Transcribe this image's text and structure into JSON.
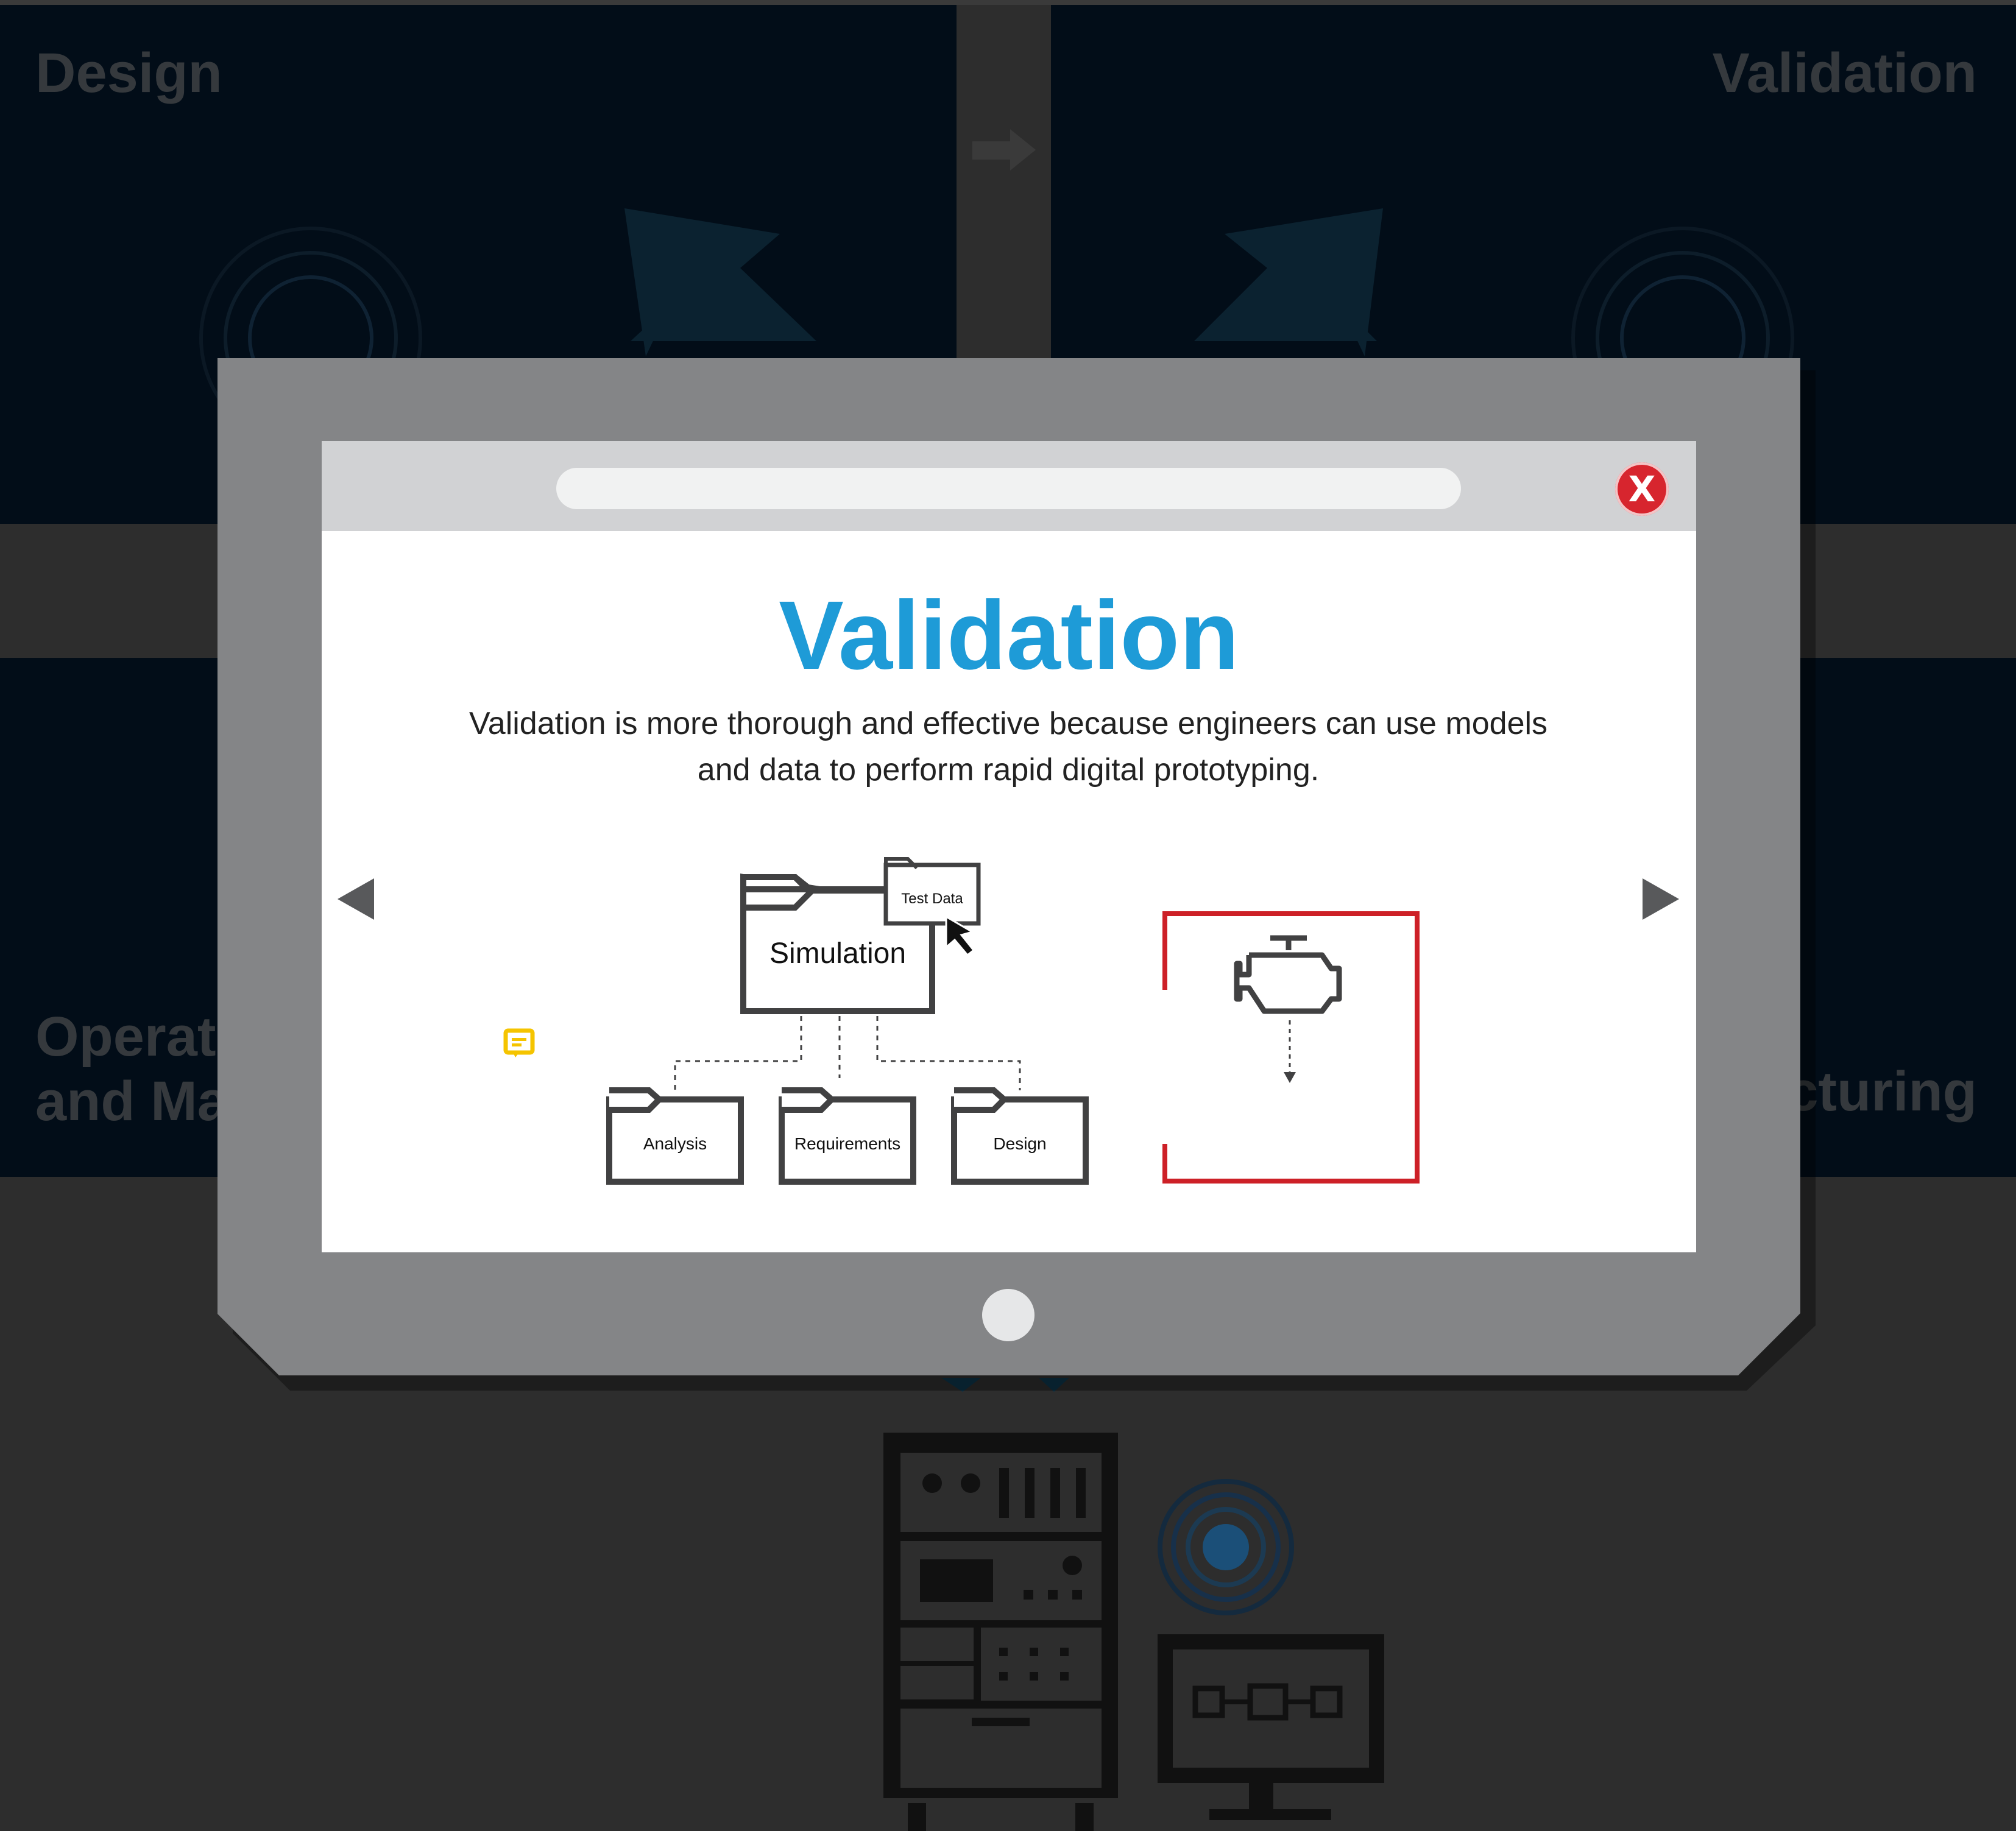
{
  "quadrants": {
    "design": "Design",
    "validation": "Validation",
    "operations": "Operat\nand Ma",
    "manufacturing": "cturing"
  },
  "modal": {
    "title": "Validation",
    "description": "Validation is more thorough and effective because engineers can use models and data to perform rapid digital prototyping.",
    "close_label": "X"
  },
  "diagram": {
    "main_folder": "Simulation",
    "test_data": "Test Data",
    "sub_folders": [
      "Analysis",
      "Requirements",
      "Design"
    ]
  },
  "colors": {
    "accent_blue": "#1e9bd7",
    "close_red": "#d7252e",
    "frame_red": "#cd2027",
    "chat_yellow": "#f5c400"
  },
  "icons": {
    "prev": "triangle-left-icon",
    "next": "triangle-right-icon",
    "engine": "engine-icon",
    "chat": "chat-bubble-icon"
  }
}
